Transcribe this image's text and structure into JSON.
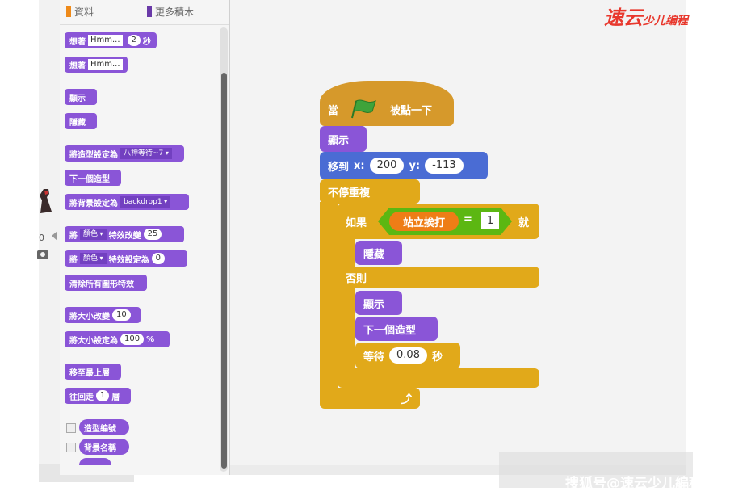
{
  "palette": {
    "categories": [
      {
        "label": "資料",
        "color": "#ee8a1a"
      },
      {
        "label": "更多積木",
        "color": "#6a3aa8"
      }
    ],
    "blocks": {
      "say_for": {
        "text": "想著",
        "input": "Hmm...",
        "secs": "2",
        "unit": "秒"
      },
      "say": {
        "text": "想著",
        "input": "Hmm..."
      },
      "show": "顯示",
      "hide": "隱藏",
      "switch_costume": {
        "text": "將造型設定為",
        "dropdown": "八神等待~7"
      },
      "next_costume": "下一個造型",
      "switch_backdrop": {
        "text": "將背景設定為",
        "dropdown": "backdrop1"
      },
      "change_effect": {
        "text1": "將",
        "effect": "顏色",
        "text2": "特效改變",
        "value": "25"
      },
      "set_effect": {
        "text1": "將",
        "effect": "顏色",
        "text2": "特效設定為",
        "value": "0"
      },
      "clear_effects": "清除所有圖形特效",
      "change_size": {
        "text": "將大小改變",
        "value": "10"
      },
      "set_size": {
        "text": "將大小設定為",
        "value": "100",
        "unit": "%"
      },
      "go_front": "移至最上層",
      "go_back": {
        "text1": "往回走",
        "value": "1",
        "text2": "層"
      },
      "costume_num": "造型編號",
      "backdrop_name": "背景名稱"
    }
  },
  "stage": {
    "zero": "0"
  },
  "script": {
    "when_flag": {
      "text1": "當",
      "text2": "被點一下"
    },
    "show1": "顯示",
    "goto": {
      "text": "移到",
      "x_label": "x:",
      "x": "200",
      "y_label": "y:",
      "y": "-113"
    },
    "forever": "不停重複",
    "if": {
      "text": "如果",
      "then": "就"
    },
    "condition": {
      "variable": "站立挨打",
      "op": "=",
      "value": "1"
    },
    "hide": "隱藏",
    "else": "否則",
    "show2": "顯示",
    "next_costume": "下一個造型",
    "wait": {
      "text": "等待",
      "value": "0.08",
      "unit": "秒"
    }
  },
  "watermarks": {
    "top": "速云",
    "top_small": "少儿编程",
    "bottom": "搜狐号@速云少儿編程"
  },
  "colors": {
    "looks": "#8a55d7",
    "control": "#e1a91a",
    "motion": "#4a6cd4",
    "operator": "#5cb712",
    "variable": "#ee7d16"
  }
}
